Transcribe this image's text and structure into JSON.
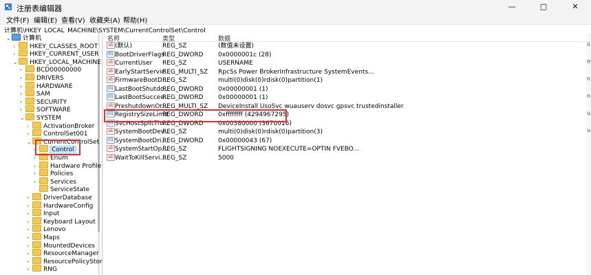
{
  "window": {
    "title": "注册表编辑器",
    "minimize": "—",
    "maximize": "□",
    "close": "✕"
  },
  "menu": [
    "文件(F)",
    "编辑(E)",
    "查看(V)",
    "收藏夹(A)",
    "帮助(H)"
  ],
  "address": "计算机\\HKEY_LOCAL_MACHINE\\SYSTEM\\CurrentControlSet\\Control",
  "tree": [
    {
      "label": "计算机",
      "chev": "⌄",
      "kind": "pc",
      "indent": 0
    },
    {
      "label": "HKEY_CLASSES_ROOT",
      "chev": "›",
      "kind": "folder",
      "indent": 1
    },
    {
      "label": "HKEY_CURRENT_USER",
      "chev": "›",
      "kind": "folder",
      "indent": 1
    },
    {
      "label": "HKEY_LOCAL_MACHINE",
      "chev": "⌄",
      "kind": "folder",
      "indent": 1
    },
    {
      "label": "BCD00000000",
      "chev": "›",
      "kind": "folder",
      "indent": 2
    },
    {
      "label": "DRIVERS",
      "chev": "›",
      "kind": "folder",
      "indent": 2
    },
    {
      "label": "HARDWARE",
      "chev": "›",
      "kind": "folder",
      "indent": 2
    },
    {
      "label": "SAM",
      "chev": "›",
      "kind": "folder",
      "indent": 2
    },
    {
      "label": "SECURITY",
      "chev": "›",
      "kind": "folder",
      "indent": 2
    },
    {
      "label": "SOFTWARE",
      "chev": "›",
      "kind": "folder",
      "indent": 2
    },
    {
      "label": "SYSTEM",
      "chev": "⌄",
      "kind": "folder",
      "indent": 2
    },
    {
      "label": "ActivationBroker",
      "chev": "›",
      "kind": "folder",
      "indent": 3
    },
    {
      "label": "ControlSet001",
      "chev": "›",
      "kind": "folder",
      "indent": 3
    },
    {
      "label": "CurrentControlSet",
      "chev": "⌄",
      "kind": "folder",
      "indent": 3
    },
    {
      "label": "Control",
      "chev": "›",
      "kind": "folder",
      "indent": 4,
      "selected": true
    },
    {
      "label": "Enum",
      "chev": "›",
      "kind": "folder",
      "indent": 4
    },
    {
      "label": "Hardware Profile",
      "chev": "›",
      "kind": "folder",
      "indent": 4
    },
    {
      "label": "Policies",
      "chev": "›",
      "kind": "folder",
      "indent": 4
    },
    {
      "label": "Services",
      "chev": "›",
      "kind": "folder",
      "indent": 4
    },
    {
      "label": "ServiceState",
      "chev": "",
      "kind": "folder",
      "indent": 4
    },
    {
      "label": "DriverDatabase",
      "chev": "›",
      "kind": "folder",
      "indent": 3
    },
    {
      "label": "HardwareConfig",
      "chev": "›",
      "kind": "folder",
      "indent": 3
    },
    {
      "label": "Input",
      "chev": "›",
      "kind": "folder",
      "indent": 3
    },
    {
      "label": "Keyboard Layout",
      "chev": "›",
      "kind": "folder",
      "indent": 3
    },
    {
      "label": "Lenovo",
      "chev": "›",
      "kind": "folder",
      "indent": 3
    },
    {
      "label": "Maps",
      "chev": "›",
      "kind": "folder",
      "indent": 3
    },
    {
      "label": "MountedDevices",
      "chev": "›",
      "kind": "folder",
      "indent": 3
    },
    {
      "label": "ResourceManager",
      "chev": "›",
      "kind": "folder",
      "indent": 3
    },
    {
      "label": "ResourcePolicyStore",
      "chev": "›",
      "kind": "folder",
      "indent": 3
    },
    {
      "label": "RNG",
      "chev": "›",
      "kind": "folder",
      "indent": 3
    }
  ],
  "columns": {
    "name": "名称",
    "type": "类型",
    "data": "数据"
  },
  "values": [
    {
      "name": "(默认)",
      "type": "REG_SZ",
      "data": "(数值未设置)",
      "icon": "ab"
    },
    {
      "name": "BootDriverFlags",
      "type": "REG_DWORD",
      "data": "0x0000001c (28)",
      "icon": "01"
    },
    {
      "name": "CurrentUser",
      "type": "REG_SZ",
      "data": "USERNAME",
      "icon": "ab"
    },
    {
      "name": "EarlyStartServic...",
      "type": "REG_MULTI_SZ",
      "data": "RpcSs Power BrokerInfrastructure SystemEvents...",
      "icon": "ab"
    },
    {
      "name": "FirmwareBootD...",
      "type": "REG_SZ",
      "data": "multi(0)disk(0)rdisk(0)partition(1)",
      "icon": "ab"
    },
    {
      "name": "LastBootShutdo...",
      "type": "REG_DWORD",
      "data": "0x00000001 (1)",
      "icon": "01"
    },
    {
      "name": "LastBootSuccee...",
      "type": "REG_DWORD",
      "data": "0x00000001 (1)",
      "icon": "01"
    },
    {
      "name": "PreshutdownOr...",
      "type": "REG_MULTI_SZ",
      "data": "DeviceInstall UsoSvc wuauserv dosvc gpsvc trustedinstaller",
      "icon": "ab"
    },
    {
      "name": "RegistrySizeLimit",
      "type": "REG_DWORD",
      "data": "0xffffffff (4294967295)",
      "icon": "01"
    },
    {
      "name": "SvcHostSplitThr...",
      "type": "REG_DWORD",
      "data": "0x00380000 (3670016)",
      "icon": "01"
    },
    {
      "name": "SystemBootDev...",
      "type": "REG_SZ",
      "data": "multi(0)disk(0)rdisk(0)partition(3)",
      "icon": "ab"
    },
    {
      "name": "SystemBootDri...",
      "type": "REG_DWORD",
      "data": "0x00000043 (67)",
      "icon": "01"
    },
    {
      "name": "SystemStartOp...",
      "type": "REG_SZ",
      "data": " FLIGHTSIGNING  NOEXECUTE=OPTIN  FVEBO...",
      "icon": "ab"
    },
    {
      "name": "WaitToKillServi...",
      "type": "REG_SZ",
      "data": "5000",
      "icon": "ab"
    }
  ],
  "edge_right": [
    "ii",
    "m",
    "n",
    "n",
    "u",
    "u"
  ],
  "edge_left": [
    "y",
    "i",
    "d"
  ],
  "colors": {
    "highlight": "#e03030",
    "selection": "#cce8ff"
  }
}
